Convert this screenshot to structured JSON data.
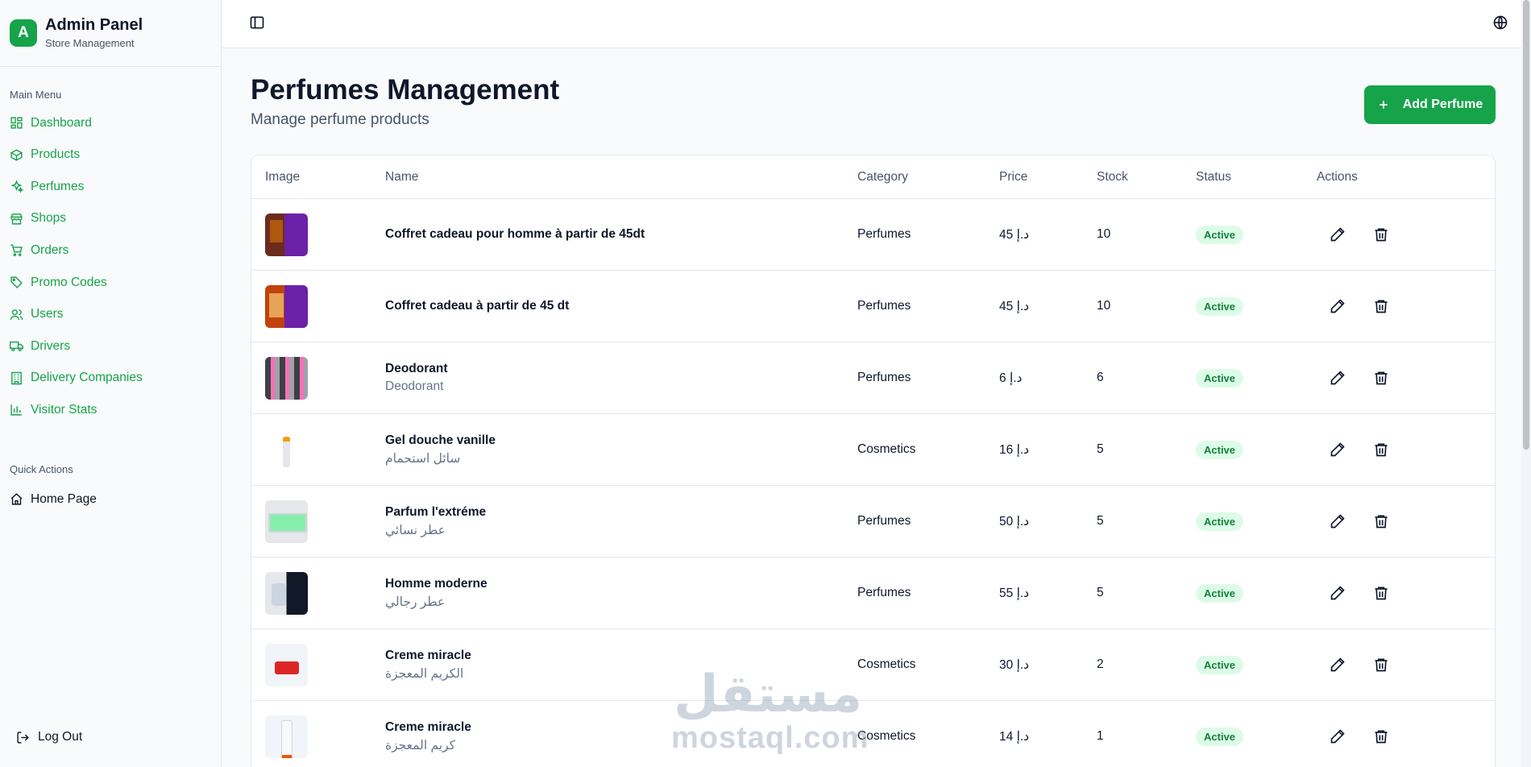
{
  "brand": {
    "logo_letter": "A",
    "title": "Admin Panel",
    "subtitle": "Store Management"
  },
  "sidebar": {
    "main_heading": "Main Menu",
    "items": [
      {
        "label": "Dashboard",
        "icon": "dashboard-icon"
      },
      {
        "label": "Products",
        "icon": "box-icon"
      },
      {
        "label": "Perfumes",
        "icon": "sparkles-icon"
      },
      {
        "label": "Shops",
        "icon": "store-icon"
      },
      {
        "label": "Orders",
        "icon": "cart-icon"
      },
      {
        "label": "Promo Codes",
        "icon": "tag-icon"
      },
      {
        "label": "Users",
        "icon": "users-icon"
      },
      {
        "label": "Drivers",
        "icon": "truck-icon"
      },
      {
        "label": "Delivery Companies",
        "icon": "building-icon"
      },
      {
        "label": "Visitor Stats",
        "icon": "bar-chart-icon"
      }
    ],
    "quick_heading": "Quick Actions",
    "quick_items": [
      {
        "label": "Home Page",
        "icon": "home-icon"
      }
    ],
    "logout_label": "Log Out"
  },
  "header": {
    "title": "Perfumes Management",
    "subtitle": "Manage perfume products",
    "add_button": "Add Perfume"
  },
  "table": {
    "columns": [
      "Image",
      "Name",
      "Category",
      "Price",
      "Stock",
      "Status",
      "Actions"
    ],
    "rows": [
      {
        "name": "Coffret cadeau pour homme à partir de 45dt",
        "subname": "",
        "category": "Perfumes",
        "price": "45 د.إ",
        "stock": "10",
        "status": "Active"
      },
      {
        "name": "Coffret cadeau à partir de 45 dt",
        "subname": "",
        "category": "Perfumes",
        "price": "45 د.إ",
        "stock": "10",
        "status": "Active"
      },
      {
        "name": "Deodorant",
        "subname": "Deodorant",
        "category": "Perfumes",
        "price": "6 د.إ",
        "stock": "6",
        "status": "Active"
      },
      {
        "name": "Gel douche vanille",
        "subname": "سائل استحمام",
        "category": "Cosmetics",
        "price": "16 د.إ",
        "stock": "5",
        "status": "Active"
      },
      {
        "name": "Parfum l'extréme",
        "subname": "عطر نسائي",
        "category": "Perfumes",
        "price": "50 د.إ",
        "stock": "5",
        "status": "Active"
      },
      {
        "name": "Homme moderne",
        "subname": "عطر رجالي",
        "category": "Perfumes",
        "price": "55 د.إ",
        "stock": "5",
        "status": "Active"
      },
      {
        "name": "Creme miracle",
        "subname": "الكريم المعجزة",
        "category": "Cosmetics",
        "price": "30 د.إ",
        "stock": "2",
        "status": "Active"
      },
      {
        "name": "Creme miracle",
        "subname": "كريم المعجزة",
        "category": "Cosmetics",
        "price": "14 د.إ",
        "stock": "1",
        "status": "Active"
      }
    ]
  },
  "watermark": {
    "arabic": "مستقل",
    "latin": "mostaql.com"
  },
  "colors": {
    "accent": "#16a34a",
    "badge_bg": "#dcfce7",
    "badge_text": "#15803d"
  }
}
